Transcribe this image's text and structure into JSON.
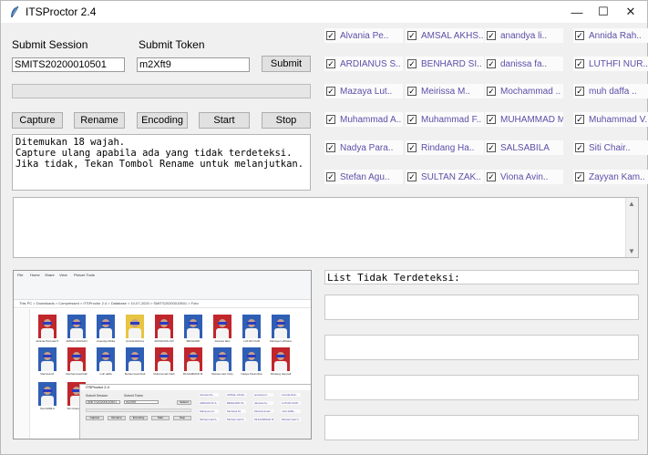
{
  "window": {
    "title": "ITSProctor 2.4",
    "controls": {
      "minimize": "—",
      "maximize": "☐",
      "close": "✕"
    }
  },
  "form": {
    "session_label": "Submit Session",
    "token_label": "Submit Token",
    "session_value": "SMITS20200010501",
    "token_value": "m2Xft9",
    "submit_label": "Submit"
  },
  "progress": {
    "value": 0
  },
  "buttons": {
    "capture": "Capture",
    "rename": "Rename",
    "encoding": "Encoding",
    "start": "Start",
    "stop": "Stop"
  },
  "message": "Ditemukan 18 wajah.\nCapture ulang apabila ada yang tidak terdeteksi.\nJika tidak, Tekan Tombol Rename untuk melanjutkan.",
  "students": [
    {
      "name": "Alvania Pe..",
      "checked": true
    },
    {
      "name": "AMSAL AKHS..",
      "checked": true
    },
    {
      "name": "anandya li..",
      "checked": true
    },
    {
      "name": "Annida Rah..",
      "checked": true
    },
    {
      "name": "ARDIANUS S..",
      "checked": true
    },
    {
      "name": "BENHARD SI..",
      "checked": true
    },
    {
      "name": "danissa fa..",
      "checked": true
    },
    {
      "name": "LUTHFI NUR..",
      "checked": true
    },
    {
      "name": "Mazaya Lut..",
      "checked": true
    },
    {
      "name": "Meirissa M..",
      "checked": true
    },
    {
      "name": "Mochammad ..",
      "checked": true
    },
    {
      "name": "muh daffa ..",
      "checked": true
    },
    {
      "name": "Muhammad A..",
      "checked": true
    },
    {
      "name": "Muhammad F..",
      "checked": true
    },
    {
      "name": "MUHAMMAD M..",
      "checked": true
    },
    {
      "name": "Muhammad V..",
      "checked": true
    },
    {
      "name": "Nadya Para..",
      "checked": true
    },
    {
      "name": "Rindang Ha..",
      "checked": true
    },
    {
      "name": "SALSABILA",
      "checked": true
    },
    {
      "name": "Siti Chair..",
      "checked": true
    },
    {
      "name": "Stefan Agu..",
      "checked": true
    },
    {
      "name": "SULTAN ZAK..",
      "checked": true
    },
    {
      "name": "Viona Avin..",
      "checked": true
    },
    {
      "name": "Zayyan Kam..",
      "checked": true
    }
  ],
  "log_text": "",
  "not_detected": {
    "label": "List Tidak Terdeteksi:",
    "items": [
      "",
      "",
      "",
      ""
    ]
  },
  "preview": {
    "ribbon_tabs": [
      "File",
      "Home",
      "Share",
      "View",
      "Picture Tools"
    ],
    "address": "This PC > Downloads > Compressed > ITSProctor 2.4 > Database > 10-07-2020 > SMITS20200010501 > Foto",
    "captions": [
      "Alvania Permata P.",
      "AMSAL AKHSAN",
      "Anandya Rizka",
      "Annida Rahma",
      "ARDIANUS ADI",
      "BENHARD",
      "danissa fatin",
      "LUTHFI NUR",
      "Mazaya Luthfiana",
      "Meirissa M.",
      "Mochammad Rafi",
      "muh daffa",
      "Muhammad Abdi",
      "Muhammad Fatih",
      "MUHAMMAD M.",
      "Muhammad Vicky",
      "Nadya Paramitha",
      "Rindang Haryadi",
      "SALSABILA",
      "Siti Chairunnisa"
    ],
    "inner_title": "ITSProctor 2.4",
    "inner_session_label": "Submit Session",
    "inner_token_label": "Submit Token",
    "inner_session_value": "SMITS20200010501",
    "inner_token_value": "m2Xft9",
    "inner_submit": "Submit",
    "inner_buttons": [
      "Capture",
      "Rename",
      "Encoding",
      "Start",
      "Stop"
    ],
    "inner_students": [
      "Alvania Pe..",
      "AMSAL AKHS..",
      "anandya li..",
      "Annida Rah..",
      "ARDIANUS S..",
      "BENHARD SI..",
      "danissa fa..",
      "LUTHFI NUR..",
      "Mazaya Lut..",
      "Meirissa M..",
      "Mochammad ..",
      "muh daffa ..",
      "Muhammad A..",
      "Muhammad F..",
      "MUHAMMAD M..",
      "Muhammad V.."
    ]
  },
  "colors": {
    "checkbox_text": "#5d4fa8",
    "mask": "#2a3cbf",
    "thumb_bg_red": "#c0262c",
    "thumb_bg_blue": "#2f5fb5"
  }
}
